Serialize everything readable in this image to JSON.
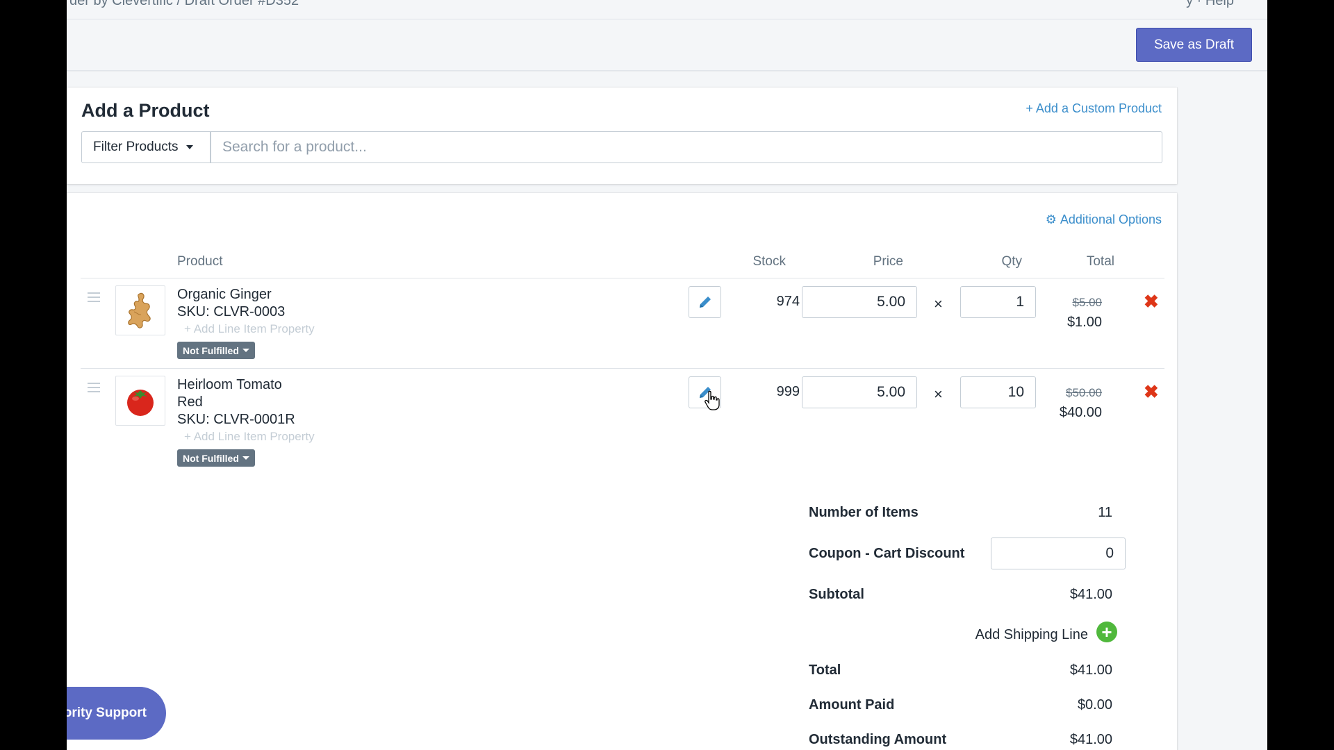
{
  "topbar": {
    "breadcrumb": "der by Clevertific / Draft Order #D352",
    "right_text": "y  ·  Help"
  },
  "actionbar": {
    "save_label": "Save as Draft"
  },
  "add_product": {
    "title": "Add a Product",
    "custom_link": "+ Add a Custom Product",
    "filter_label": "Filter Products",
    "search_placeholder": "Search for a product..."
  },
  "line_items": {
    "additional_options": "Additional Options",
    "headers": {
      "product": "Product",
      "stock": "Stock",
      "price": "Price",
      "qty": "Qty",
      "total": "Total"
    },
    "items": [
      {
        "name": "Organic Ginger",
        "sku": "SKU: CLVR-0003",
        "add_property": "+ Add Line Item Property",
        "status": "Not Fulfilled",
        "stock": "974",
        "price": "5.00",
        "qty": "1",
        "total_old": "$5.00",
        "total_new": "$1.00",
        "remove_icon": "close-icon"
      },
      {
        "name": "Heirloom Tomato",
        "variant": "Red",
        "sku": "SKU: CLVR-0001R",
        "add_property": "+ Add Line Item Property",
        "status": "Not Fulfilled",
        "stock": "999",
        "price": "5.00",
        "qty": "10",
        "total_old": "$50.00",
        "total_new": "$40.00",
        "remove_icon": "close-icon"
      }
    ],
    "times_symbol": "×",
    "remove_symbol": "✖"
  },
  "summary": {
    "num_items_label": "Number of Items",
    "num_items_value": "11",
    "coupon_label": "Coupon - Cart Discount",
    "coupon_value": "0",
    "subtotal_label": "Subtotal",
    "subtotal_value": "$41.00",
    "shipping_label": "Add Shipping Line",
    "total_label": "Total",
    "total_value": "$41.00",
    "paid_label": "Amount Paid",
    "paid_value": "$0.00",
    "outstanding_label": "Outstanding Amount",
    "outstanding_value": "$41.00"
  },
  "support": {
    "label": "Priority Support"
  },
  "colors": {
    "accent": "#5c6ac4",
    "link": "#3b8ecb",
    "danger": "#de3618",
    "success": "#50b83c"
  }
}
